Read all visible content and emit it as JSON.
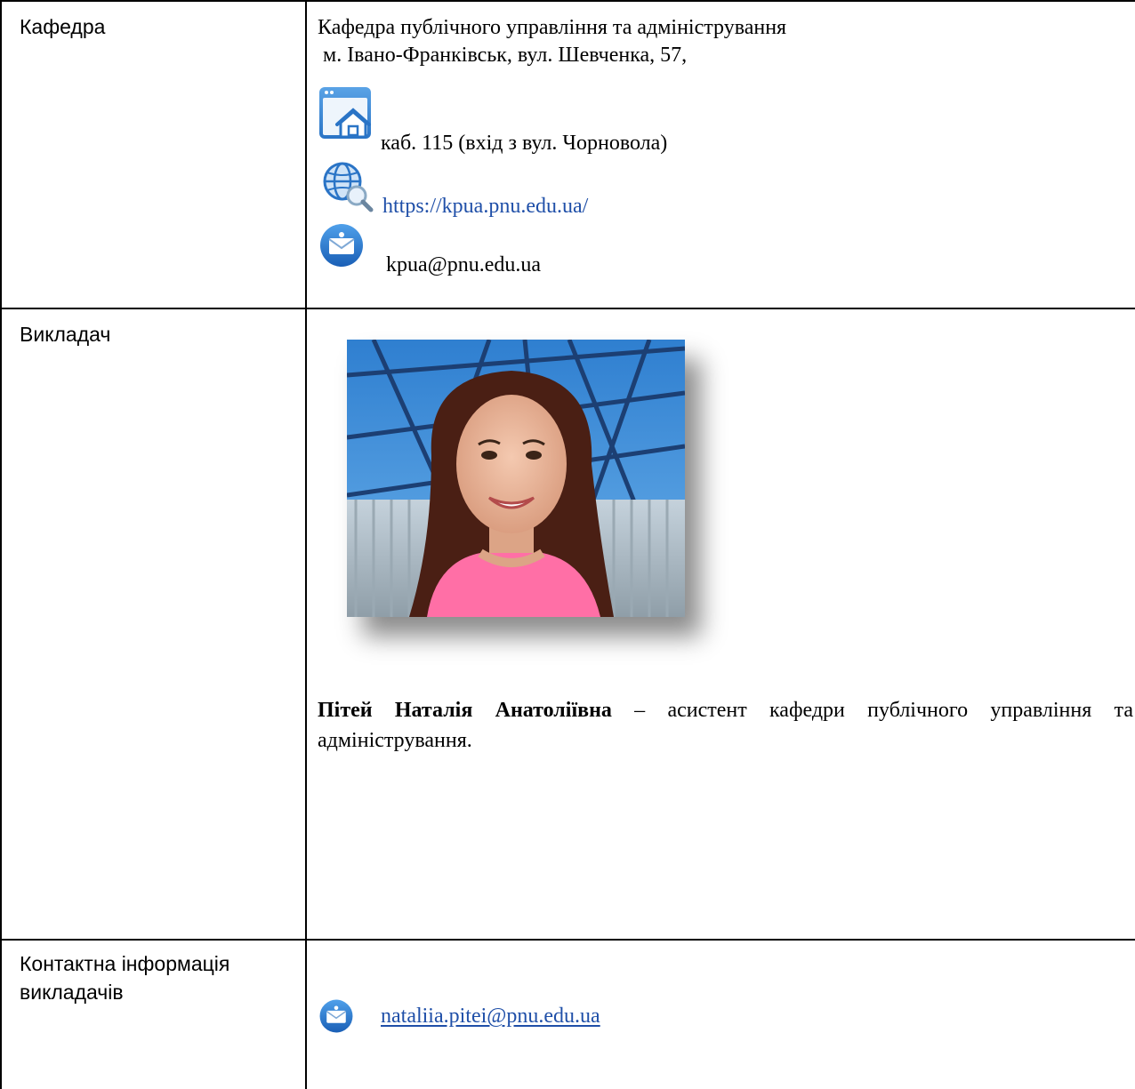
{
  "rows": [
    {
      "label": "Кафедра",
      "lines": {
        "name": "Кафедра публічного управління та адміністрування",
        "address": " м. Івано-Франківськ, вул. Шевченка, 57,",
        "room": "каб. 115 (вхід з вул. Чорновола)",
        "website": "https://kpua.pnu.edu.ua/",
        "email": "kpua@pnu.edu.ua"
      },
      "icons": [
        "office-building-icon",
        "globe-search-icon",
        "envelope-icon"
      ]
    },
    {
      "label": "Викладач",
      "photo_icon": "teacher-photo",
      "bio_name": "Пітей Наталія Анатоліївна",
      "bio_text": " – асистент кафедри публічного управління та адміністрування."
    },
    {
      "label_line1": "Контактна інформація",
      "label_line2": "викладачів",
      "email": "nataliia.pitei@pnu.edu.ua",
      "icons": [
        "envelope-icon"
      ]
    }
  ],
  "colors": {
    "link": "#1f4fa8",
    "grid": "#000000"
  }
}
